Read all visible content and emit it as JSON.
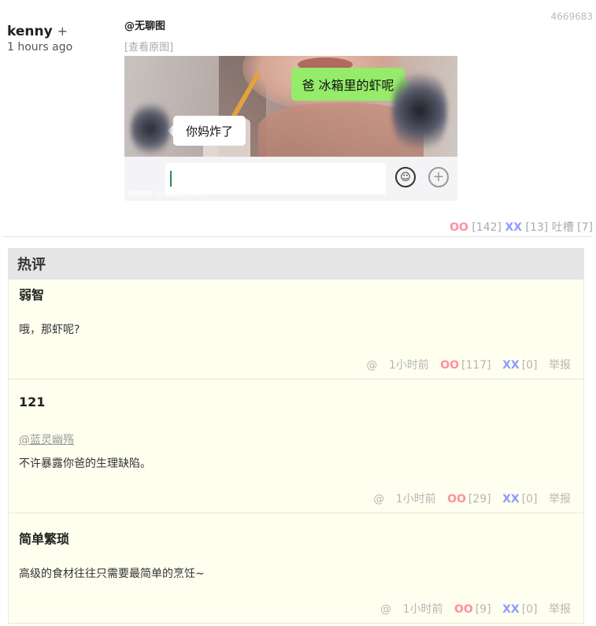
{
  "post": {
    "id": "4669683",
    "author": "kenny",
    "follow_symbol": "+",
    "time": "1 hours ago",
    "source": "@无聊图",
    "view_original": "[查看原图]",
    "image": {
      "bubble_green": "爸 冰箱里的虾呢",
      "bubble_white": "你妈炸了",
      "emoji_glyph": "☺",
      "plus_glyph": "+",
      "watermark": "HUPU @缺脑接帅哥"
    },
    "votes": {
      "oo_label": "OO",
      "oo_count": "[142]",
      "xx_label": "XX",
      "xx_count": "[13]",
      "tucao_label": "吐槽",
      "tucao_count": "[7]"
    }
  },
  "hot_comments": {
    "title": "热评",
    "items": [
      {
        "author": "弱智",
        "mention": "",
        "text": "哦，那虾呢?",
        "at": "@",
        "time": "1小时前",
        "oo_label": "OO",
        "oo_count": "[117]",
        "xx_label": "XX",
        "xx_count": "[0]",
        "report": "举报"
      },
      {
        "author": "121",
        "mention": "@蓝灵幽殇",
        "text": "不许暴露你爸的生理缺陷。",
        "at": "@",
        "time": "1小时前",
        "oo_label": "OO",
        "oo_count": "[29]",
        "xx_label": "XX",
        "xx_count": "[0]",
        "report": "举报"
      },
      {
        "author": "简单繁琐",
        "mention": "",
        "text": "高级的食材往往只需要最简单的烹饪~",
        "at": "@",
        "time": "1小时前",
        "oo_label": "OO",
        "oo_count": "[9]",
        "xx_label": "XX",
        "xx_count": "[0]",
        "report": "举报"
      }
    ]
  },
  "colors": {
    "oo": "#ff8f9a",
    "xx": "#8f9bff",
    "comment_bg": "#fffff0",
    "header_bg": "#e5e5e5",
    "bubble_green": "#95eb6a"
  }
}
